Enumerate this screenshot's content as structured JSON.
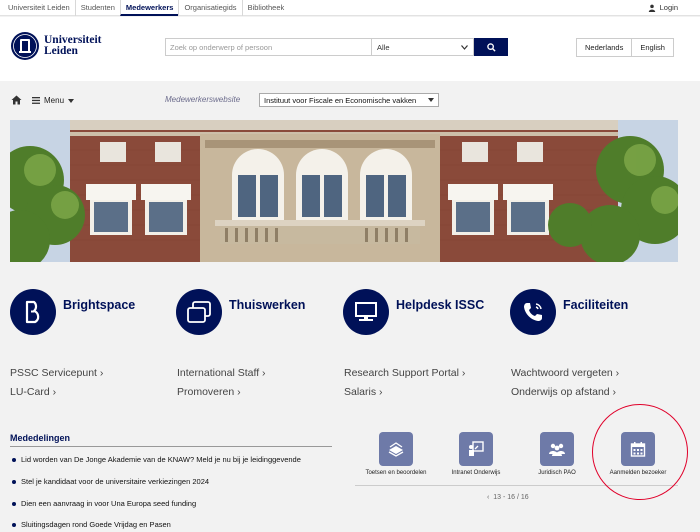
{
  "topnav": {
    "links": [
      "Universiteit Leiden",
      "Studenten",
      "Medewerkers",
      "Organisatiegids",
      "Bibliotheek"
    ],
    "active_index": 2,
    "login": "Login"
  },
  "header": {
    "logo_line1": "Universiteit",
    "logo_line2": "Leiden",
    "search_placeholder": "Zoek op onderwerp of persoon",
    "search_scope": "Alle",
    "languages": [
      "Nederlands",
      "English"
    ]
  },
  "subbar": {
    "menu_label": "Menu",
    "site_label": "Medewerkerswebsite",
    "site_select": "Instituut voor Fiscale en Economische vakken"
  },
  "quick_tiles": [
    {
      "label": "Brightspace",
      "icon": "brightspace-icon"
    },
    {
      "label": "Thuiswerken",
      "icon": "windows-icon"
    },
    {
      "label": "Helpdesk ISSC",
      "icon": "monitor-icon"
    },
    {
      "label": "Faciliteiten",
      "icon": "phone-icon"
    }
  ],
  "links": [
    [
      "PSSC Servicepunt",
      "LU-Card"
    ],
    [
      "International Staff",
      "Promoveren"
    ],
    [
      "Research Support Portal",
      "Salaris"
    ],
    [
      "Wachtwoord vergeten",
      "Onderwijs op afstand"
    ]
  ],
  "mededelingen": {
    "title": "Mededelingen",
    "items": [
      "Lid worden van De Jonge Akademie van de KNAW? Meld je nu bij je leidinggevende",
      "Stel je kandidaat voor de universitaire verkiezingen 2024",
      "Dien een aanvraag in voor Una Europa seed funding",
      "Sluitingsdagen rond Goede Vrijdag en Pasen"
    ]
  },
  "bottom_tiles": [
    {
      "label": "Toetsen en beoordelen",
      "icon": "books-icon"
    },
    {
      "label": "Intranet Onderwijs",
      "icon": "presentation-icon"
    },
    {
      "label": "Juridisch PAO",
      "icon": "group-icon"
    },
    {
      "label": "Aanmelden bezoeker",
      "icon": "calendar-icon"
    }
  ],
  "pager": "13 - 16 / 16",
  "colors": {
    "brand": "#001158",
    "tile_bg": "#6e7aa8",
    "highlight": "#e0002a"
  }
}
